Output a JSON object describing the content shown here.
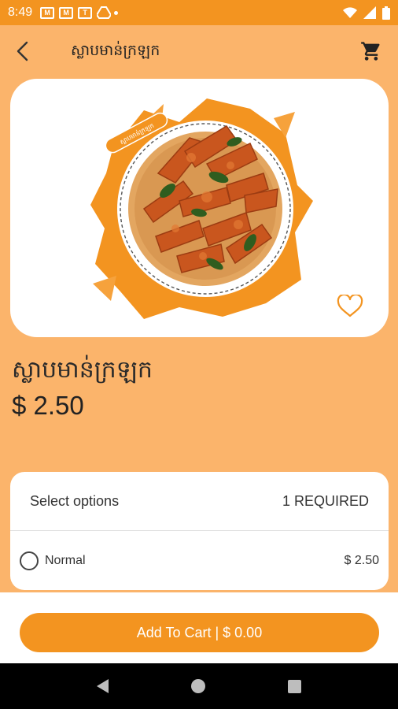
{
  "status_bar": {
    "time": "8:49",
    "notification_icons": [
      "gmail-icon",
      "gmail-icon",
      "calendar-icon",
      "drive-icon"
    ],
    "calendar_glyph": "T"
  },
  "header": {
    "title": "ស្លាបមាន់ក្រឡក"
  },
  "product": {
    "name": "ស្លាបមាន់ក្រឡក",
    "price": "$ 2.50",
    "sticker_text": "ស្លាបមាន់ក្រឡក"
  },
  "options": {
    "heading": "Select options",
    "requirement": "1 REQUIRED",
    "items": [
      {
        "label": "Normal",
        "price": "$ 2.50",
        "selected": false
      }
    ]
  },
  "cart_button": {
    "label": "Add To Cart | $ 0.00"
  },
  "colors": {
    "accent": "#f39420",
    "background": "#fbb46b"
  }
}
